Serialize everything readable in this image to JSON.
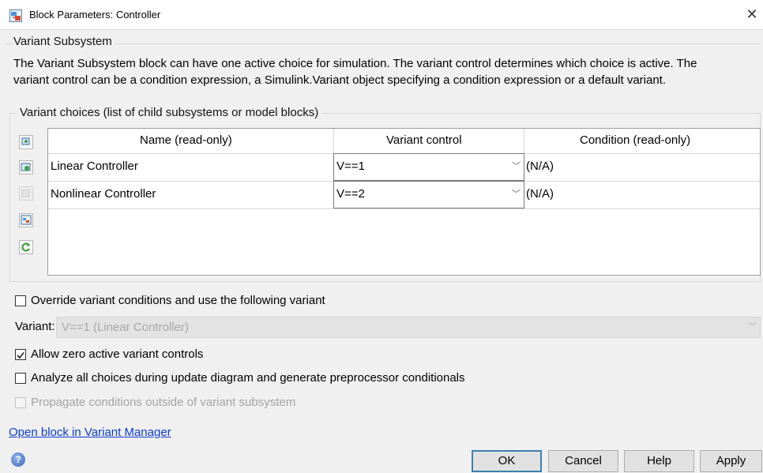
{
  "window": {
    "title": "Block Parameters: Controller"
  },
  "group": {
    "title": "Variant Subsystem",
    "description_line1": "The Variant Subsystem block can have one active choice for simulation. The variant control determines which choice is active. The",
    "description_line2": "variant control can be a condition expression, a Simulink.Variant object specifying a condition expression or a default variant."
  },
  "choices": {
    "title": "Variant choices (list of child subsystems or model blocks)",
    "columns": [
      "Name (read-only)",
      "Variant control",
      "Condition (read-only)"
    ],
    "rows": [
      {
        "name": "Linear Controller",
        "control": "V==1",
        "condition": "(N/A)"
      },
      {
        "name": "Nonlinear Controller",
        "control": "V==2",
        "condition": "(N/A)"
      }
    ],
    "side_buttons": [
      "add-choice-icon",
      "add-model-choice-icon",
      "delete-choice-icon",
      "create-choice-icon",
      "refresh-icon"
    ]
  },
  "options": {
    "override": {
      "label": "Override variant conditions and use the following variant",
      "checked": false
    },
    "variant_label": "Variant:",
    "variant_value": "V==1 (Linear Controller)",
    "allow_zero": {
      "label": "Allow zero active variant controls",
      "checked": true
    },
    "analyze_all": {
      "label": "Analyze all choices during update diagram and generate preprocessor conditionals",
      "checked": false
    },
    "propagate": {
      "label": "Propagate conditions outside of variant subsystem",
      "checked": false
    }
  },
  "link_text": "Open block in Variant Manager",
  "buttons": {
    "ok": "OK",
    "cancel": "Cancel",
    "help": "Help",
    "apply": "Apply"
  },
  "colors": {
    "link": "#0b3bd0",
    "default_button_border": "#3c7fb1"
  }
}
